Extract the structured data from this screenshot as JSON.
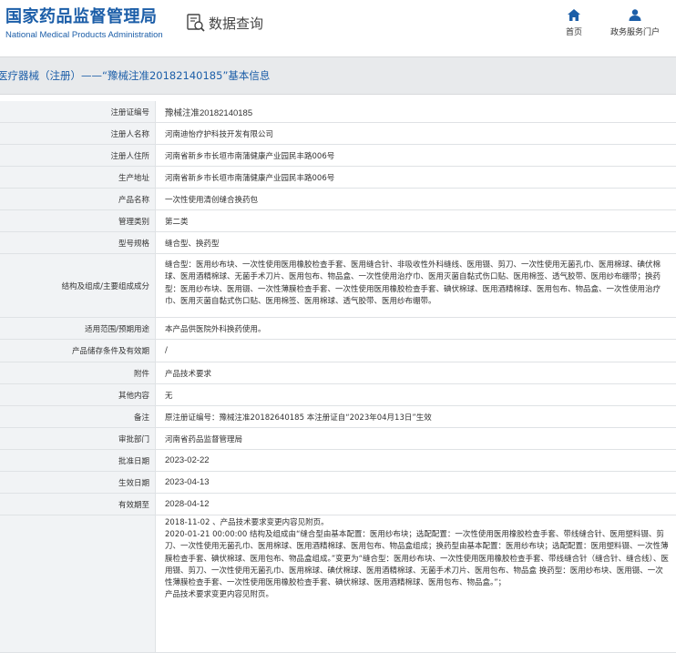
{
  "header": {
    "logo_cn": "国家药品监督管理局",
    "logo_en": "National Medical Products Administration",
    "query_label": "数据查询",
    "nav": [
      {
        "label": "首页",
        "icon": "home-icon"
      },
      {
        "label": "政务服务门户",
        "icon": "user-icon"
      }
    ]
  },
  "title": "医疗器械（注册）——“豫械注准20182140185”基本信息",
  "colors": {
    "brand": "#1c5ea8",
    "label_bg": "#f1f3f5",
    "title_bg": "#e8eaec",
    "border": "#dfe2e5"
  },
  "rows": [
    {
      "label": "注册证编号",
      "value": "豫械注准20182140185"
    },
    {
      "label": "注册人名称",
      "value": "河南迪怡疗护科技开发有限公司"
    },
    {
      "label": "注册人住所",
      "value": "河南省新乡市长垣市南蒲健康产业园民丰路006号"
    },
    {
      "label": "生产地址",
      "value": "河南省新乡市长垣市南蒲健康产业园民丰路006号"
    },
    {
      "label": "产品名称",
      "value": "一次性使用清创缝合换药包"
    },
    {
      "label": "管理类别",
      "value": "第二类"
    },
    {
      "label": "型号规格",
      "value": "缝合型、换药型"
    },
    {
      "label": "结构及组成/主要组成成分",
      "value": "缝合型：医用纱布块、一次性使用医用橡胶检查手套、医用缝合针、非吸收性外科缝线、医用镊、剪刀、一次性使用无菌孔巾、医用棉球、碘伏棉球、医用酒精棉球、无菌手术刀片、医用包布、物品盒、一次性使用治疗巾、医用灭菌自黏式伤口贴、医用棉签、透气胶带、医用纱布绷带；换药型：医用纱布块、医用镊、一次性薄膜检查手套、一次性使用医用橡胶检查手套、碘伏棉球、医用酒精棉球、医用包布、物品盒、一次性使用治疗巾、医用灭菌自黏式伤口贴、医用棉签、医用棉球、透气胶带、医用纱布绷带。"
    },
    {
      "label": "适用范围/预期用途",
      "value": "本产品供医院外科换药使用。"
    },
    {
      "label": "产品储存条件及有效期",
      "value": "/"
    },
    {
      "label": "附件",
      "value": "产品技术要求"
    },
    {
      "label": "其他内容",
      "value": "无"
    },
    {
      "label": "备注",
      "value": "原注册证编号：豫械注准20182640185 本注册证自“2023年04月13日”生效"
    },
    {
      "label": "审批部门",
      "value": "河南省药品监督管理局"
    },
    {
      "label": "批准日期",
      "value": "2023-02-22"
    },
    {
      "label": "生效日期",
      "value": "2023-04-13"
    },
    {
      "label": "有效期至",
      "value": "2028-04-12"
    }
  ],
  "change_history": {
    "lines": [
      "2018-11-02 、产品技术要求变更内容见附页。",
      "2020-01-21 00:00:00 结构及组成由“缝合型由基本配置：医用纱布块；选配配置：一次性使用医用橡胶检查手套、带线缝合针、医用塑料镊、剪刀、一次性使用无菌孔巾、医用棉球、医用酒精棉球、医用包布、物品盒组成；换药型由基本配置：医用纱布块；选配配置：医用塑料镊、一次性薄膜检查手套、碘伏棉球、医用包布、物品盒组成。”变更为“缝合型：医用纱布块、一次性使用医用橡胶检查手套、带线缝合针（缝合针、缝合线）、医用镊、剪刀、一次性使用无菌孔巾、医用棉球、碘伏棉球、医用酒精棉球、无菌手术刀片、医用包布、物品盒 换药型：医用纱布块、医用镊、一次性薄膜检查手套、一次性使用医用橡胶检查手套、碘伏棉球、医用酒精棉球、医用包布、物品盒。”；",
      "产品技术要求变更内容见附页。"
    ]
  }
}
